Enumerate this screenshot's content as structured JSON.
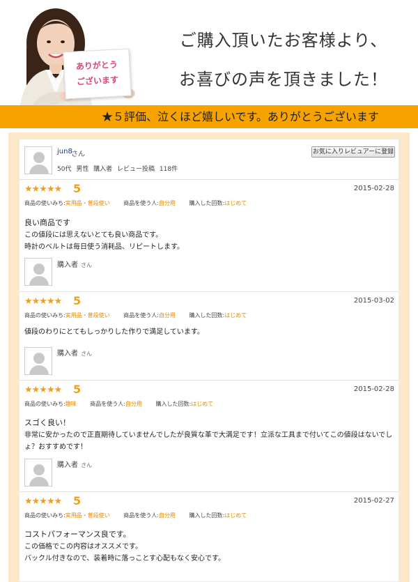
{
  "banner": {
    "headline_line1": "ご購入頂いたお客様より、",
    "headline_line2": "お喜びの声を頂きました！",
    "card_line1": "ありがとう",
    "card_line2": "ございます",
    "ribbon": "★５評価、泣くほど嬉しいです。ありがとうございます",
    "colors": {
      "ribbon": "#f6a300",
      "panel_bg": "#fbe9c9",
      "accent": "#f0a020"
    }
  },
  "reviewer": {
    "name": "jun8",
    "suffix": "さん",
    "meta": "50代 男性 購入者 レビュー投稿 118件",
    "favorite_button": "お気に入りレビュアーに登録"
  },
  "labels": {
    "usage": "商品の使いみち:",
    "user": "商品を使う人:",
    "times": "購入した回数:"
  },
  "reviews": [
    {
      "stars": "★★★★★",
      "score": "5",
      "date": "2015-02-28",
      "usage": "実用品・普段使い",
      "user": "自分用",
      "times": "はじめて",
      "title": "良い商品です",
      "body": "この値段には思えないとても良い商品です。\n時計のベルトは毎日使う消耗品、リピートします。",
      "buyer": "購入者",
      "buyer_suffix": "さん"
    },
    {
      "stars": "★★★★★",
      "score": "5",
      "date": "2015-03-02",
      "usage": "実用品・普段使い",
      "user": "自分用",
      "times": "はじめて",
      "title": "",
      "body": "値段のわりにとてもしっかりした作りで満足しています。",
      "buyer": "購入者",
      "buyer_suffix": "さん"
    },
    {
      "stars": "★★★★★",
      "score": "5",
      "date": "2015-02-28",
      "usage": "趣味",
      "user": "自分用",
      "times": "はじめて",
      "title": "スゴく良い！",
      "body": "非常に安かったので正直期待していませんでしたが良質な革で大満足です！立派な工具まで付いてこの値段はないでしょ？おすすめです！",
      "buyer": "購入者",
      "buyer_suffix": "さん"
    },
    {
      "stars": "★★★★★",
      "score": "5",
      "date": "2015-02-27",
      "usage": "実用品・普段使い",
      "user": "自分用",
      "times": "はじめて",
      "title": "コストパフォーマンス良です。",
      "body": "この価格でこの内容はオススメです。\nバックル付きなので、装着時に落っことす心配もなく安心です。",
      "buyer": "",
      "buyer_suffix": ""
    }
  ]
}
